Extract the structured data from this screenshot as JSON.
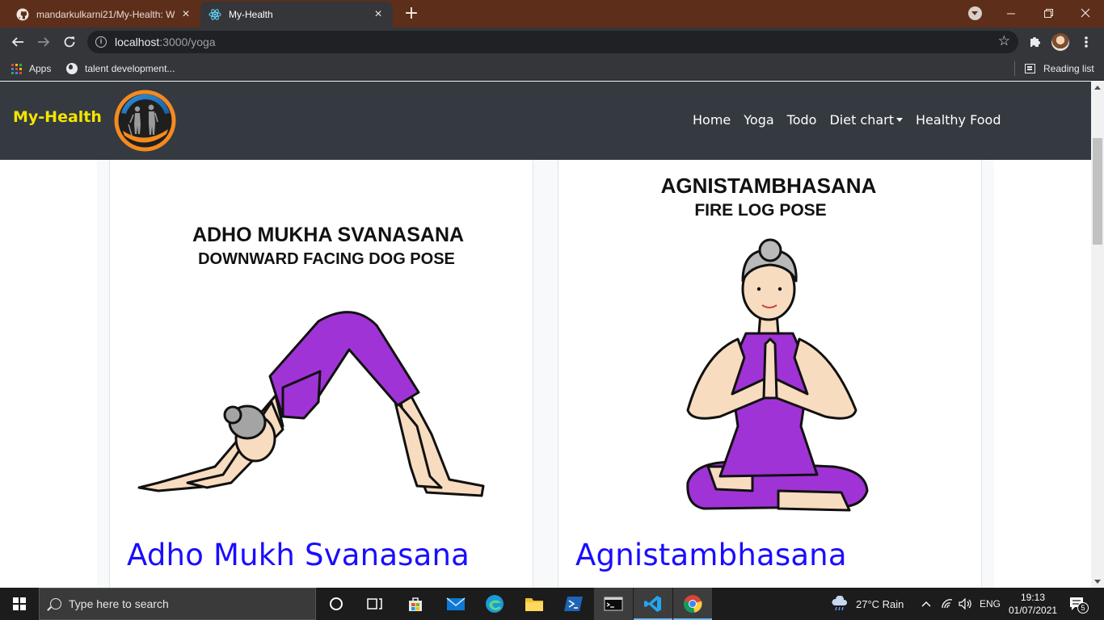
{
  "browser": {
    "tabs": [
      {
        "title": "mandarkulkarni21/My-Health: W",
        "icon": "github-icon",
        "active": false
      },
      {
        "title": "My-Health",
        "icon": "react-icon",
        "active": true
      }
    ],
    "url_host": "localhost",
    "url_path": ":3000/yoga",
    "bookmarks": [
      {
        "label": "Apps",
        "icon": "apps-grid-icon"
      },
      {
        "label": "talent development...",
        "icon": "globe-icon"
      }
    ],
    "reading_list": "Reading list"
  },
  "page": {
    "brand": "My-Health",
    "nav": [
      {
        "label": "Home"
      },
      {
        "label": "Yoga"
      },
      {
        "label": "Todo"
      },
      {
        "label": "Diet chart",
        "dropdown": true
      },
      {
        "label": "Healthy Food"
      }
    ],
    "cards": [
      {
        "image_caption_line1": "ADHO MUKHA SVANASANA",
        "image_caption_line2": "DOWNWARD FACING DOG POSE",
        "title": "Adho Mukh Svanasana"
      },
      {
        "image_caption_line1": "AGNISTAMBHASANA",
        "image_caption_line2": "FIRE LOG POSE",
        "title": "Agnistambhasana"
      }
    ],
    "colors": {
      "navbar": "#343a40",
      "brand": "#f4e400",
      "card_title": "#1a0dff",
      "outfit": "#a033d6"
    }
  },
  "taskbar": {
    "search_placeholder": "Type here to search",
    "weather": "27°C  Rain",
    "language": "ENG",
    "time": "19:13",
    "date": "01/07/2021",
    "notifications": "5"
  }
}
